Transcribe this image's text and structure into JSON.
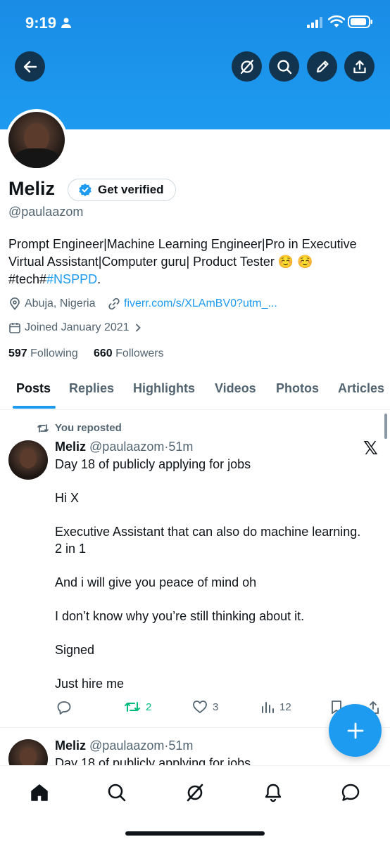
{
  "status_bar": {
    "time": "9:19"
  },
  "profile": {
    "name": "Meliz",
    "get_verified": "Get verified",
    "handle": "@paulaazom",
    "bio_main": "Prompt Engineer|Machine Learning Engineer|Pro in Executive Virtual Assistant|Computer guru| Product Tester ☺️ ☺️",
    "bio_prefix": "#tech#",
    "bio_tag": "#NSPPD",
    "bio_suffix": ".",
    "location": "Abuja, Nigeria",
    "link": "fiverr.com/s/XLAmBV0?utm_...",
    "joined": "Joined January 2021",
    "following_count": "597",
    "following_label": "Following",
    "followers_count": "660",
    "followers_label": "Followers"
  },
  "tabs": [
    "Posts",
    "Replies",
    "Highlights",
    "Videos",
    "Photos",
    "Articles"
  ],
  "active_tab": "Posts",
  "posts": [
    {
      "repost_label": "You reposted",
      "name": "Meliz",
      "handle": "@paulaazom",
      "dot": "·",
      "time": "51m",
      "text": "Day 18 of publicly applying for jobs\n\nHi X\n\nExecutive Assistant that can also do machine learning. 2 in 1\n\nAnd i will give you peace of mind oh\n\nI don’t know why you’re still thinking about it.\n\nSigned\n\nJust hire me",
      "reposts": "2",
      "likes": "3",
      "views": "12"
    },
    {
      "name": "Meliz",
      "handle": "@paulaazom",
      "dot": "·",
      "time": "51m",
      "text": "Day 18 of publicly applying for jobs"
    }
  ],
  "colors": {
    "accent": "#1d9bf0",
    "repost_green": "#00ba7c",
    "text": "#0f1419",
    "muted": "#536471"
  }
}
